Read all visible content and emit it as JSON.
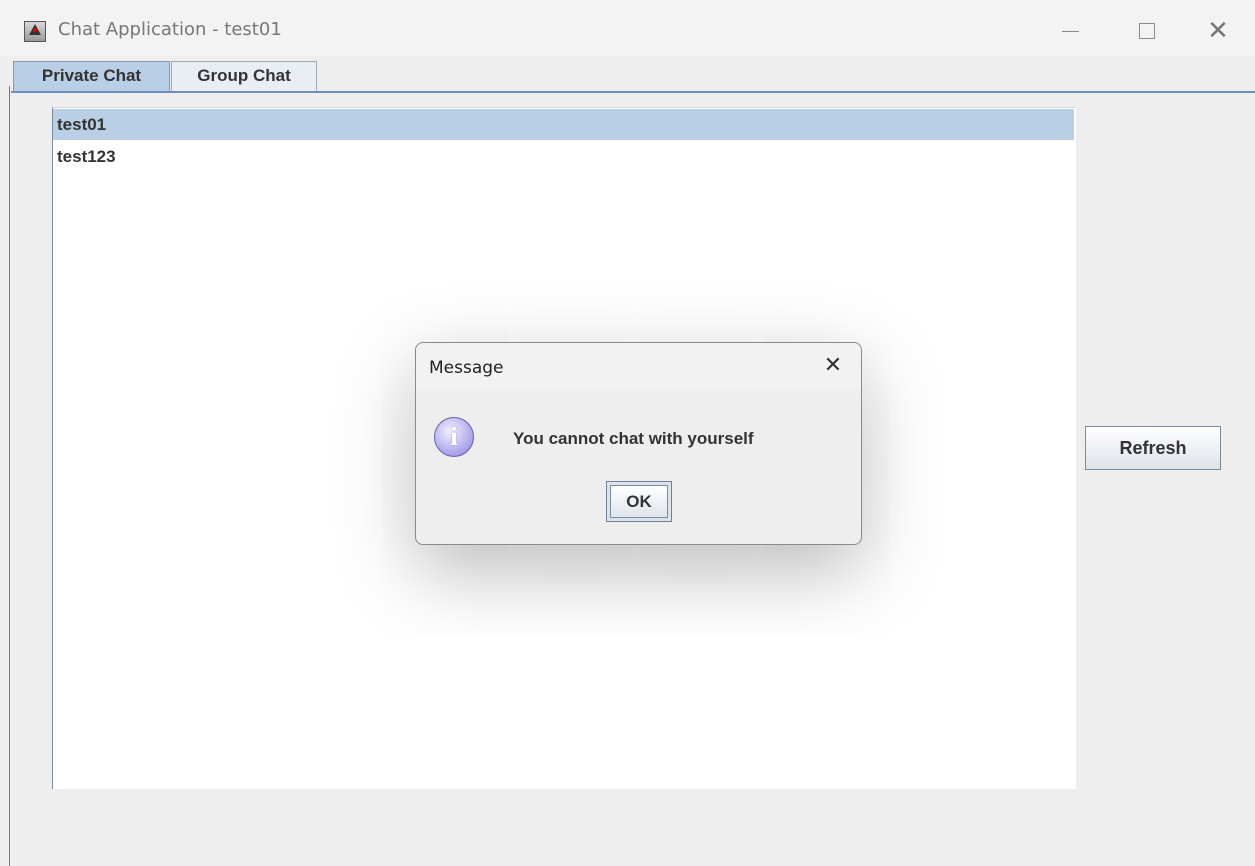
{
  "window": {
    "title": "Chat Application - test01",
    "controls": [
      "minimize",
      "maximize",
      "close"
    ]
  },
  "tabs": [
    {
      "label": "Private Chat",
      "selected": true
    },
    {
      "label": "Group Chat",
      "selected": false
    }
  ],
  "users_list": {
    "items": [
      {
        "label": "test01",
        "selected": true
      },
      {
        "label": "test123",
        "selected": false
      }
    ]
  },
  "refresh_button": {
    "label": "Refresh"
  },
  "dialog": {
    "title": "Message",
    "icon": "info-icon",
    "icon_glyph": "i",
    "message": "You cannot chat with yourself",
    "ok_label": "OK",
    "close_glyph": "✕"
  },
  "glyphs": {
    "window_close": "✕"
  },
  "colors": {
    "selection": "#b8cfe5",
    "tab_underline": "#6f8fc0",
    "background": "#eeeeee"
  }
}
